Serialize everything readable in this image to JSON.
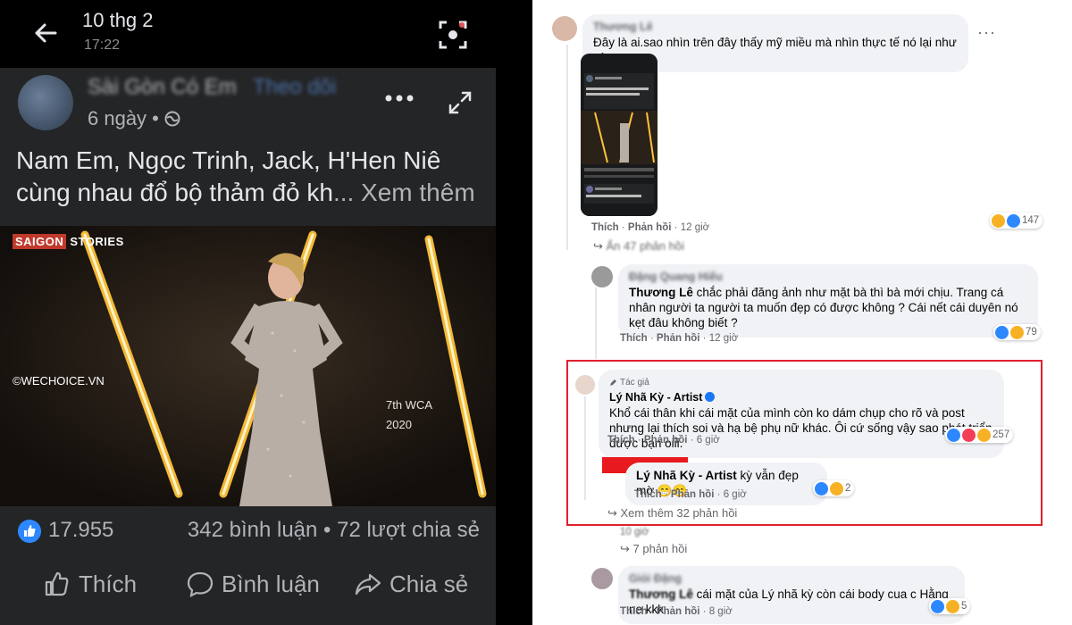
{
  "mobile": {
    "topbar": {
      "date": "10 thg 2",
      "time": "17:22"
    },
    "post": {
      "page_name": "Sài Gòn Có Em",
      "follow_label": "Theo dõi",
      "age": "6 ngày",
      "caption_main": "Nam Em, Ngọc Trinh, Jack, H'Hen Niê cùng nhau đổ bộ thảm đỏ kh",
      "caption_more": "... Xem thêm",
      "image": {
        "brand_tag": "SAIGON",
        "brand_rest": " STORIES",
        "watermark": "©WECHOICE.VN",
        "event_line1": "7th WCA",
        "event_line2": "2020"
      },
      "likes": "17.955",
      "counts": "342 bình luận • 72 lượt chia sẻ",
      "actions": {
        "like": "Thích",
        "comment": "Bình luận",
        "share": "Chia sẻ"
      }
    }
  },
  "comments": {
    "c1": {
      "name": "Thương Lê",
      "text": "Đây là ai.sao nhìn trên đây thấy mỹ miều mà nhìn thực tế nó lại như này",
      "like": "Thích",
      "reply": "Phản hồi",
      "time": "12 giờ",
      "reactions": "147",
      "hidden_replies": "Ẩn 47 phản hồi"
    },
    "c2": {
      "name": "Đặng Quang Hiếu",
      "mention": "Thương Lê",
      "text": " chắc phải đăng ảnh như mặt bà thì bà mới chịu. Trang cá nhân người ta người ta muốn đẹp có được không ? Cái nết cái duyên nó kẹt đâu không biết ?",
      "like": "Thích",
      "reply": "Phản hồi",
      "time": "12 giờ",
      "reactions": "79"
    },
    "c3": {
      "author_tag": "Tác giả",
      "name": "Lý Nhã Kỳ - Artist",
      "text": "Khổ cái thân khi cái mặt của mình còn ko dám chụp cho rõ và post nhưng lại thích soi và hạ bệ phụ nữ khác. Ôi cứ sống vậy sao phát triển được bạn oiii.",
      "like": "Thích",
      "reply": "Phản hồi",
      "time": "6 giờ",
      "reactions": "257"
    },
    "c4": {
      "mention": "Lý Nhã Kỳ - Artist",
      "text": " kỳ vẫn đẹp mờ 😁😁",
      "like": "Thích",
      "reply": "Phản hồi",
      "time": "6 giờ",
      "reactions": "2"
    },
    "see_more": "Xem thêm 32 phản hồi",
    "c5": {
      "time": "10 giờ",
      "replies": "7 phản hồi"
    },
    "c6": {
      "name": "Giỏi Đặng",
      "mention": "Thương Lê",
      "text": " cái mặt của Lý nhã kỳ còn cái body cua c Hằng ne kkk",
      "like": "Thích",
      "reply": "Phản hồi",
      "time": "8 giờ",
      "reactions": "5"
    }
  },
  "colors": {
    "dark_bg": "#242526",
    "fb_blue": "#2d88ff",
    "highlight_red": "#e0202e"
  }
}
